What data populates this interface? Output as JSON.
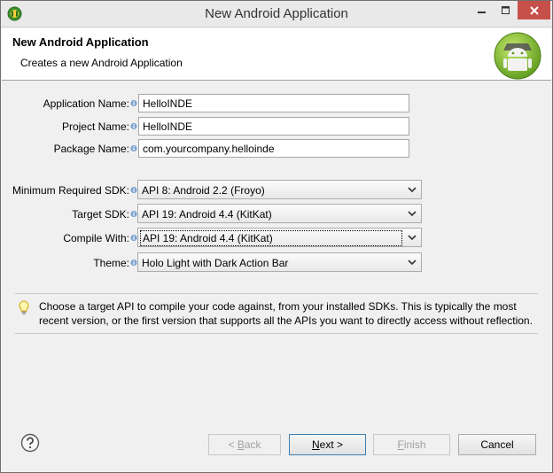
{
  "window": {
    "title": "New Android Application"
  },
  "banner": {
    "title": "New Android Application",
    "subtitle": "Creates a new Android Application"
  },
  "form": {
    "application_name": {
      "label": "Application Name:",
      "value": "HelloINDE"
    },
    "project_name": {
      "label": "Project Name:",
      "value": "HelloINDE"
    },
    "package_name": {
      "label": "Package Name:",
      "value": "com.yourcompany.helloinde"
    },
    "min_sdk": {
      "label": "Minimum Required SDK:",
      "value": "API 8: Android 2.2 (Froyo)"
    },
    "target_sdk": {
      "label": "Target SDK:",
      "value": "API 19: Android 4.4 (KitKat)"
    },
    "compile_with": {
      "label": "Compile With:",
      "value": "API 19: Android 4.4 (KitKat)"
    },
    "theme": {
      "label": "Theme:",
      "value": "Holo Light with Dark Action Bar"
    }
  },
  "hint": {
    "text": "Choose a target API to compile your code against, from your installed SDKs. This is typically the most recent version, or the first version that supports all the APIs you want to directly access without reflection."
  },
  "buttons": {
    "back": {
      "prefix": "< ",
      "mnemonic": "B",
      "rest": "ack"
    },
    "next": {
      "mnemonic": "N",
      "rest": "ext >"
    },
    "finish": {
      "mnemonic": "F",
      "rest": "inish"
    },
    "cancel": "Cancel"
  },
  "colors": {
    "close_button": "#c7504a",
    "android_green": "#8bc34a",
    "default_button_border": "#3c7fb1"
  },
  "icons": {
    "app": "eclipse-icon",
    "logo": "android-logo-icon",
    "info": "info-icon",
    "hint": "lightbulb-icon",
    "help": "help-icon"
  }
}
